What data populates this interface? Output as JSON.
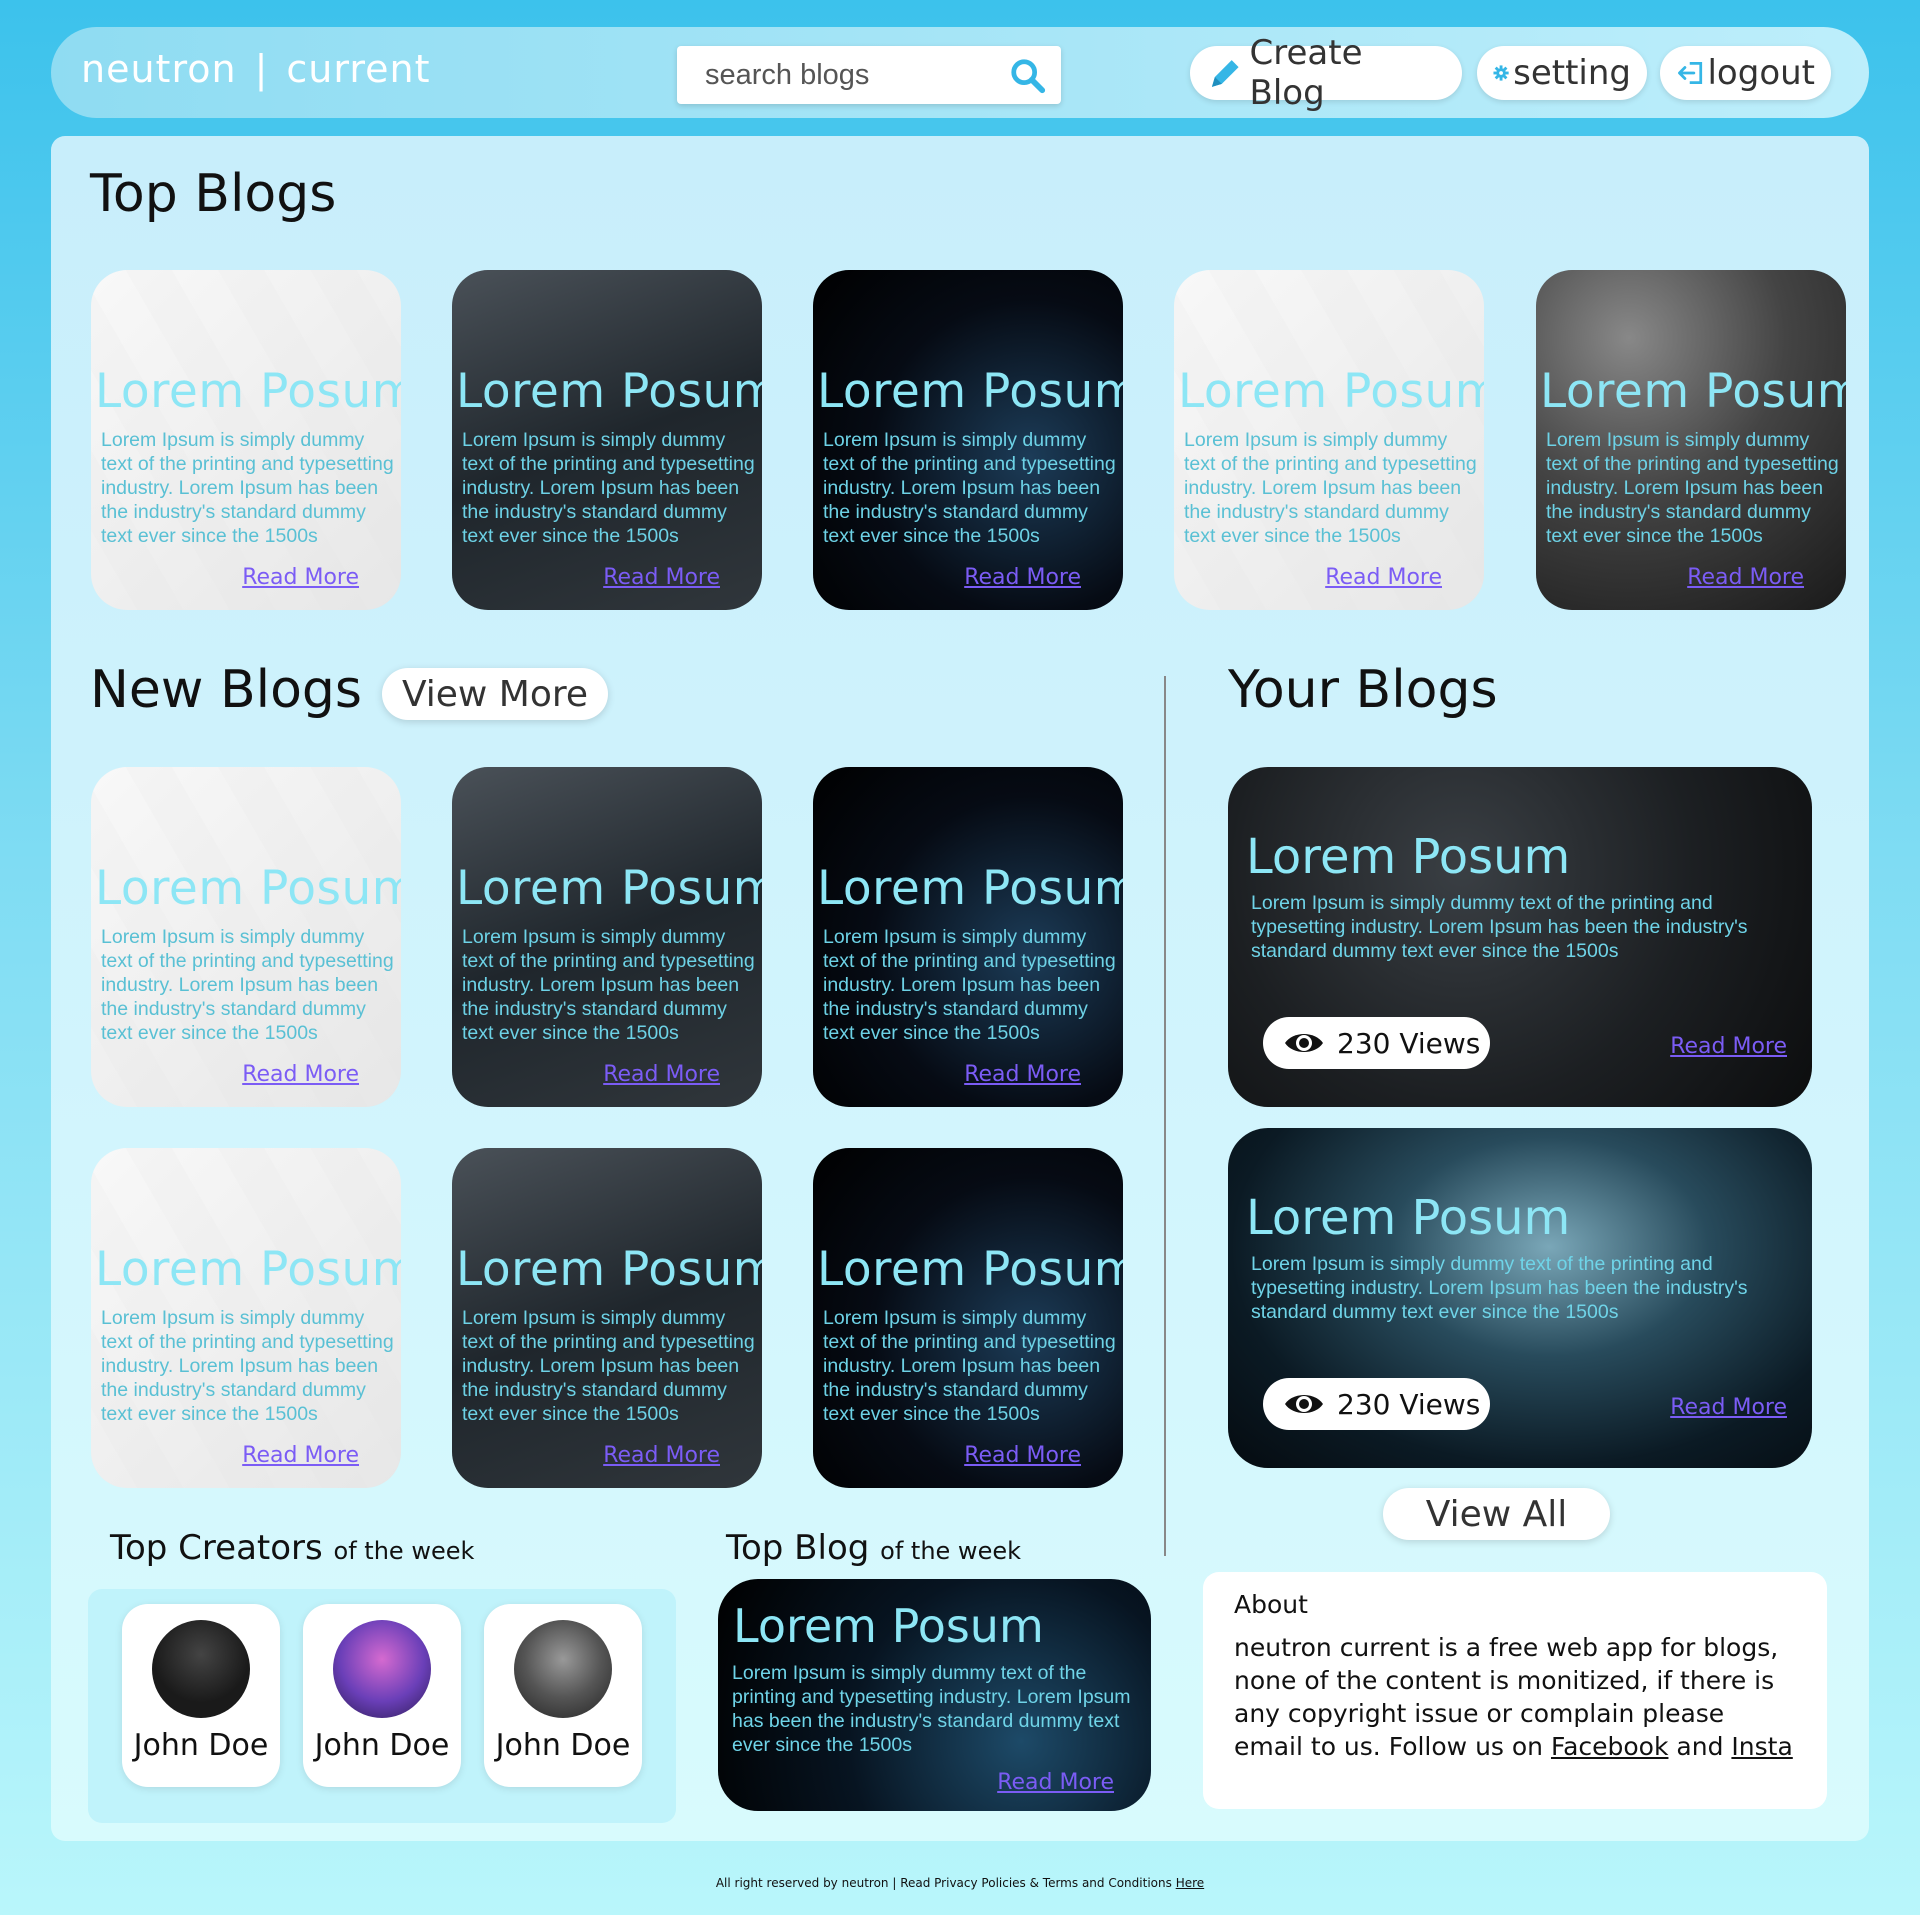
{
  "header": {
    "brand_left": "neutron",
    "brand_sep": "|",
    "brand_right": "current",
    "search_placeholder": "search blogs",
    "create_label": "Create Blog",
    "setting_label": "setting",
    "logout_label": "logout"
  },
  "top_blogs": {
    "title": "Top Blogs",
    "cards": [
      {
        "style": "light",
        "title": "Lorem Posum",
        "text": "Lorem Ipsum is simply dummy text of the printing and typesetting industry. Lorem Ipsum has been the industry's standard dummy text ever since the 1500s",
        "link": "Read More"
      },
      {
        "style": "dark1",
        "title": "Lorem Posum",
        "text": "Lorem Ipsum is simply dummy text of the printing and typesetting industry. Lorem Ipsum has been the industry's standard dummy text ever since the 1500s",
        "link": "Read More"
      },
      {
        "style": "dark2",
        "title": "Lorem Posum",
        "text": "Lorem Ipsum is simply dummy text of the printing and typesetting industry. Lorem Ipsum has been the industry's standard dummy text ever since the 1500s",
        "link": "Read More"
      },
      {
        "style": "light",
        "title": "Lorem Posum",
        "text": "Lorem Ipsum is simply dummy text of the printing and typesetting industry. Lorem Ipsum has been the industry's standard dummy text ever since the 1500s",
        "link": "Read More"
      },
      {
        "style": "hex",
        "title": "Lorem Posum",
        "text": "Lorem Ipsum is simply dummy text of the printing and typesetting industry. Lorem Ipsum has been the industry's standard dummy text ever since the 1500s",
        "link": "Read More"
      }
    ]
  },
  "new_blogs": {
    "title": "New Blogs",
    "view_more": "View More",
    "cards": [
      {
        "style": "light",
        "title": "Lorem Posum",
        "text": "Lorem Ipsum is simply dummy text of the printing and typesetting industry. Lorem Ipsum has been the industry's standard dummy text ever since the 1500s",
        "link": "Read More"
      },
      {
        "style": "dark1",
        "title": "Lorem Posum",
        "text": "Lorem Ipsum is simply dummy text of the printing and typesetting industry. Lorem Ipsum has been the industry's standard dummy text ever since the 1500s",
        "link": "Read More"
      },
      {
        "style": "dark2",
        "title": "Lorem Posum",
        "text": "Lorem Ipsum is simply dummy text of the printing and typesetting industry. Lorem Ipsum has been the industry's standard dummy text ever since the 1500s",
        "link": "Read More"
      },
      {
        "style": "light",
        "title": "Lorem Posum",
        "text": "Lorem Ipsum is simply dummy text of the printing and typesetting industry. Lorem Ipsum has been the industry's standard dummy text ever since the 1500s",
        "link": "Read More"
      },
      {
        "style": "dark1",
        "title": "Lorem Posum",
        "text": "Lorem Ipsum is simply dummy text of the printing and typesetting industry. Lorem Ipsum has been the industry's standard dummy text ever since the 1500s",
        "link": "Read More"
      },
      {
        "style": "dark2",
        "title": "Lorem Posum",
        "text": "Lorem Ipsum is simply dummy text of the printing and typesetting industry. Lorem Ipsum has been the industry's standard dummy text ever since the 1500s",
        "link": "Read More"
      }
    ]
  },
  "your_blogs": {
    "title": "Your Blogs",
    "view_all": "View All",
    "cards": [
      {
        "style": "leaves",
        "title": "Lorem Posum",
        "text": "Lorem Ipsum is simply dummy text of the printing and typesetting industry. Lorem Ipsum has been the industry's standard dummy text ever since the 1500s",
        "views": "230 Views",
        "link": "Read More"
      },
      {
        "style": "fog",
        "title": "Lorem Posum",
        "text": "Lorem Ipsum is simply dummy text of the printing and typesetting industry. Lorem Ipsum has been the industry's standard dummy text ever since the 1500s",
        "views": "230 Views",
        "link": "Read More"
      }
    ]
  },
  "top_creators": {
    "title": "Top Creators",
    "suffix": "of the week",
    "creators": [
      {
        "name": "John Doe",
        "avatar_color": "#1a1a1a"
      },
      {
        "name": "John Doe",
        "avatar_color": "#8a3fb5"
      },
      {
        "name": "John Doe",
        "avatar_color": "#5a5a5a"
      }
    ]
  },
  "top_blog_week": {
    "title": "Top Blog",
    "suffix": "of the week",
    "card": {
      "title": "Lorem Posum",
      "text": "Lorem Ipsum is simply dummy text of the printing and typesetting industry. Lorem Ipsum has been the industry's standard dummy text ever since the 1500s",
      "link": "Read More"
    }
  },
  "about": {
    "heading": "About",
    "body": "neutron current is a free web app for blogs, none of the content is monitized, if there is any copyright issue or complain please email to us. Follow us on",
    "facebook": "Facebook",
    "and": "and",
    "insta": "Insta"
  },
  "footer": {
    "text": "All right reserved by neutron | Read Privacy Policies & Terms and Conditions",
    "link": "Here"
  },
  "colors": {
    "accent": "#3cc2ec",
    "card_title": "#8de6f5",
    "link": "#7b5cf5"
  }
}
